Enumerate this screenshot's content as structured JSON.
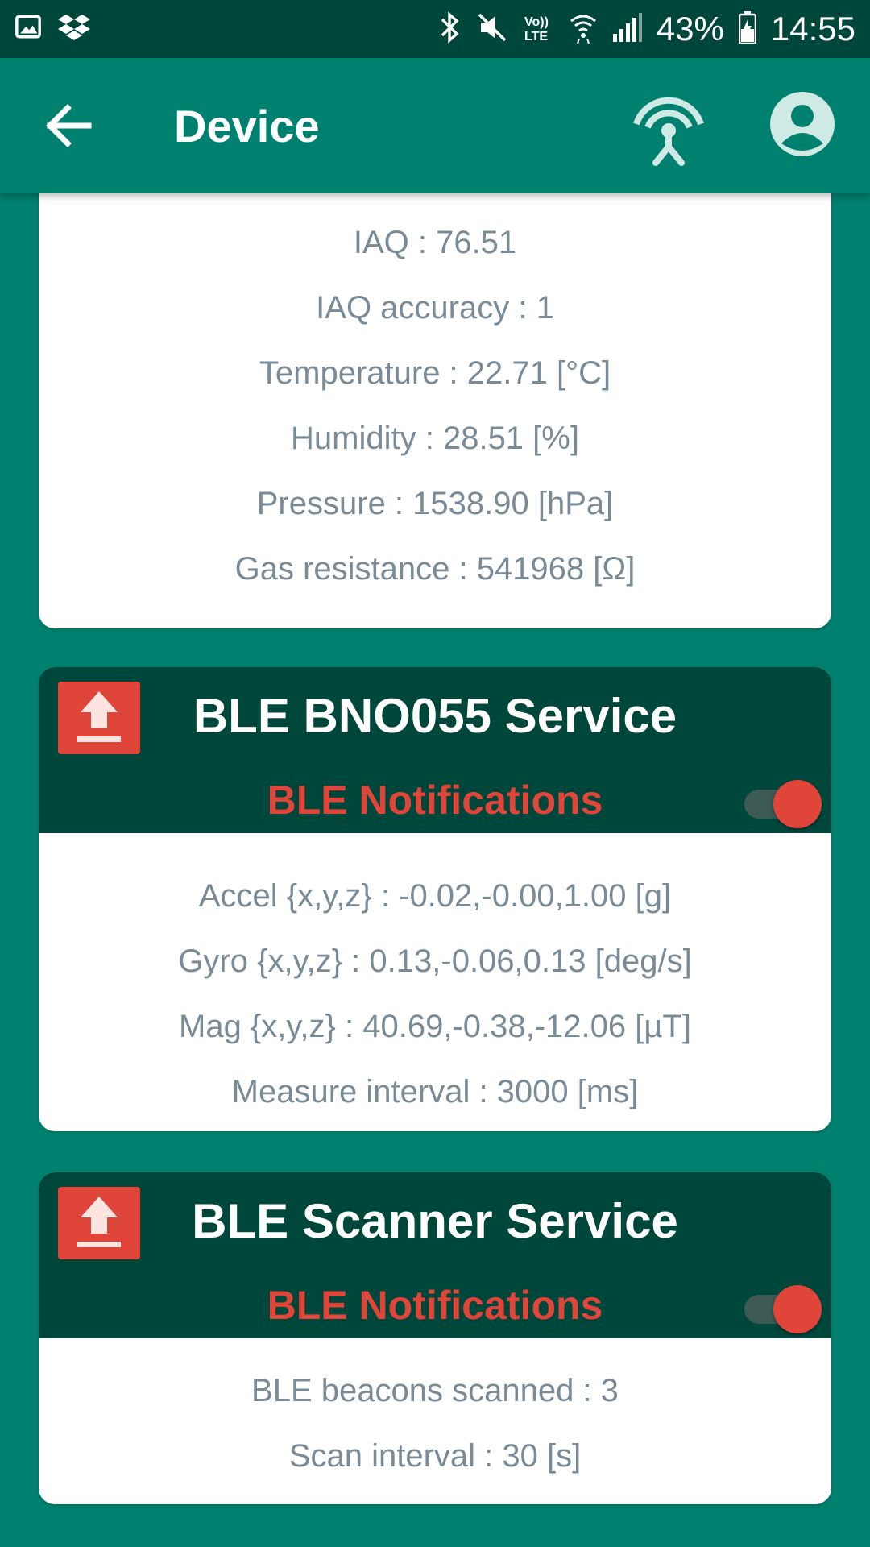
{
  "status_bar": {
    "battery": "43%",
    "time": "14:55"
  },
  "app_bar": {
    "title": "Device"
  },
  "env_card": {
    "lines": [
      "IAQ : 76.51",
      "IAQ accuracy : 1",
      "Temperature : 22.71 [°C]",
      "Humidity : 28.51 [%]",
      "Pressure : 1538.90 [hPa]",
      "Gas resistance : 541968 [Ω]"
    ]
  },
  "bno_card": {
    "title": "BLE BNO055 Service",
    "notifications_label": "BLE Notifications",
    "notifications_on": true,
    "lines": [
      "Accel {x,y,z} : -0.02,-0.00,1.00 [g]",
      "Gyro {x,y,z} : 0.13,-0.06,0.13 [deg/s]",
      "Mag {x,y,z} : 40.69,-0.38,-12.06 [µT]",
      "Measure interval : 3000 [ms]"
    ]
  },
  "scanner_card": {
    "title": "BLE Scanner Service",
    "notifications_label": "BLE Notifications",
    "notifications_on": true,
    "lines": [
      "BLE beacons scanned : 3",
      "Scan interval : 30 [s]"
    ]
  },
  "colors": {
    "primary": "#00806e",
    "primary_dark": "#00473b",
    "accent": "#e0453a",
    "value_text": "#7a8b98"
  }
}
